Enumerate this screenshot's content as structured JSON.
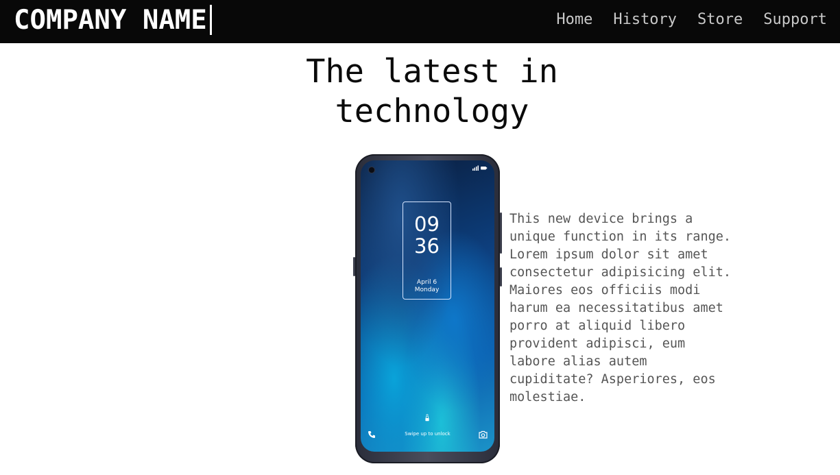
{
  "header": {
    "brand": "COMPANY NAME",
    "nav": [
      {
        "label": "Home"
      },
      {
        "label": "History"
      },
      {
        "label": "Store"
      },
      {
        "label": "Support"
      }
    ]
  },
  "main": {
    "headline_line1": "The latest in",
    "headline_line2": "technology",
    "description": "This new device brings a\nunique function in its range.\nLorem ipsum dolor sit amet\nconsectetur adipisicing elit.\nMaiores eos officiis modi\nharum ea necessitatibus amet\nporro at aliquid libero\nprovident adipisci, eum\nlabore alias autem\ncupiditate? Asperiores, eos\nmolestiae."
  },
  "phone_screen": {
    "clock_hours": "09",
    "clock_minutes": "36",
    "date": "April 6",
    "day": "Monday",
    "unlock_hint": "Swipe up to unlock",
    "icons": [
      "phone-icon",
      "lock-icon",
      "camera-icon",
      "signal-icon",
      "battery-icon"
    ]
  },
  "colors": {
    "navbar_bg": "#080808",
    "brand_text": "#ffffff",
    "nav_text": "#c9c9c9",
    "headline_text": "#0a0a0a",
    "body_text": "#555555"
  }
}
